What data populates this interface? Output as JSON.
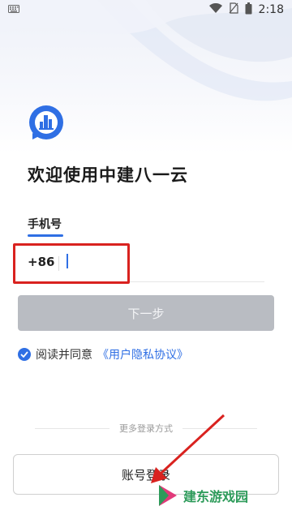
{
  "status_bar": {
    "time": "2:18",
    "icons": [
      "keyboard-icon",
      "wifi-icon",
      "no-sim-icon",
      "battery-icon"
    ]
  },
  "app": {
    "logo_icon": "app-logo-icon",
    "welcome_title": "欢迎使用中建八一云"
  },
  "login_form": {
    "tab_phone": "手机号",
    "country_code": "+86",
    "phone_value": "",
    "phone_placeholder": "",
    "next_button": "下一步",
    "agree_prefix": "阅读并同意",
    "agreement_link": "《用户隐私协议》",
    "agreed": true
  },
  "other_methods": {
    "label": "更多登录方式",
    "account_login": "账号登录"
  },
  "watermark": {
    "text": "建东游戏园"
  },
  "colors": {
    "accent": "#2f6fe4",
    "highlight": "#d9221f",
    "disabled_button": "#b9bcc2"
  }
}
